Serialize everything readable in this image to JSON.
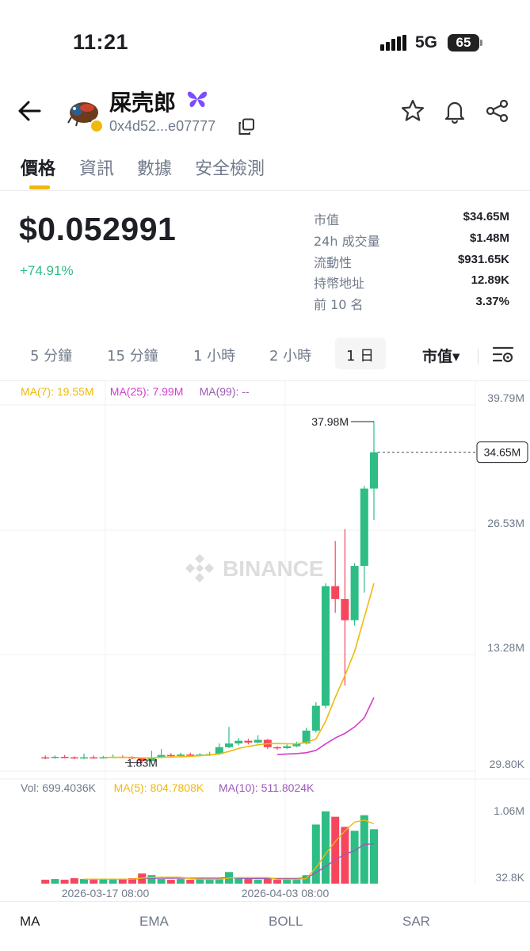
{
  "status_bar": {
    "time": "11:21",
    "network": "5G",
    "battery": "65"
  },
  "header": {
    "token_name": "屎壳郎",
    "address": "0x4d52...e07777"
  },
  "tabs": [
    {
      "label": "價格",
      "active": true
    },
    {
      "label": "資訊",
      "active": false
    },
    {
      "label": "數據",
      "active": false
    },
    {
      "label": "安全檢測",
      "active": false
    }
  ],
  "price": {
    "value": "$0.052991",
    "change": "+74.91%"
  },
  "stats": [
    {
      "label": "市值",
      "value": "$34.65M"
    },
    {
      "label": "24h 成交量",
      "value": "$1.48M"
    },
    {
      "label": "流動性",
      "value": "$931.65K"
    },
    {
      "label": "持幣地址",
      "value": "12.89K"
    },
    {
      "label": "前 10 名",
      "value": "3.37%"
    }
  ],
  "intervals": [
    {
      "label": "5 分鐘",
      "active": false
    },
    {
      "label": "15 分鐘",
      "active": false
    },
    {
      "label": "1 小時",
      "active": false
    },
    {
      "label": "2 小時",
      "active": false
    },
    {
      "label": "1 日",
      "active": true
    }
  ],
  "metric_selector": "市值▾",
  "indicators": [
    {
      "label": "MA",
      "active": true
    },
    {
      "label": "EMA",
      "active": false
    },
    {
      "label": "BOLL",
      "active": false
    },
    {
      "label": "SAR",
      "active": false
    }
  ],
  "colors": {
    "up": "#2ebd85",
    "down": "#f6465d",
    "ma7": "#f0b90b",
    "ma25": "#d63ad0",
    "ma99": "#9b59b6",
    "accent": "#f0b90b"
  },
  "chart_data": {
    "type": "candlestick",
    "ma_legend": [
      {
        "label": "MA(7): 19.55M",
        "color": "#f0b90b"
      },
      {
        "label": "MA(25): 7.99M",
        "color": "#d63ad0"
      },
      {
        "label": "MA(99): --",
        "color": "#9b59b6"
      }
    ],
    "y_ticks": [
      "39.79M",
      "26.53M",
      "13.28M",
      "29.80K"
    ],
    "y_range": [
      0.0298,
      39.79
    ],
    "current_value_label": "34.65M",
    "current_value": 34.65,
    "high_label": "37.98M",
    "low_label": "1.83M",
    "x_labels": [
      "2026-03-17 08:00",
      "2026-04-03 08:00"
    ],
    "watermark": "BINANCE",
    "candles": [
      [
        1.5,
        1.45,
        1.7,
        1.3
      ],
      [
        1.45,
        1.55,
        1.7,
        1.35
      ],
      [
        1.55,
        1.5,
        1.75,
        1.4
      ],
      [
        1.5,
        1.4,
        1.6,
        1.3
      ],
      [
        1.4,
        1.5,
        1.9,
        1.3
      ],
      [
        1.5,
        1.45,
        1.7,
        1.35
      ],
      [
        1.45,
        1.5,
        1.65,
        1.35
      ],
      [
        1.5,
        1.55,
        1.8,
        1.4
      ],
      [
        1.55,
        1.5,
        1.7,
        1.4
      ],
      [
        1.5,
        1.4,
        1.6,
        1.3
      ],
      [
        1.4,
        1.1,
        1.5,
        0.9
      ],
      [
        1.1,
        1.5,
        2.2,
        1.0
      ],
      [
        1.5,
        1.75,
        2.4,
        1.4
      ],
      [
        1.75,
        1.65,
        1.95,
        1.5
      ],
      [
        1.65,
        1.8,
        2.0,
        1.55
      ],
      [
        1.8,
        1.75,
        2.0,
        1.6
      ],
      [
        1.75,
        1.8,
        1.95,
        1.6
      ],
      [
        1.8,
        1.85,
        2.1,
        1.65
      ],
      [
        1.85,
        2.6,
        3.0,
        1.75
      ],
      [
        2.6,
        3.0,
        4.8,
        2.5
      ],
      [
        3.0,
        3.3,
        3.6,
        2.8
      ],
      [
        3.3,
        3.1,
        3.5,
        2.9
      ],
      [
        3.1,
        3.4,
        3.9,
        3.0
      ],
      [
        3.4,
        2.6,
        3.5,
        2.4
      ],
      [
        2.6,
        2.5,
        2.7,
        2.3
      ],
      [
        2.5,
        2.7,
        2.9,
        2.4
      ],
      [
        2.7,
        3.0,
        3.2,
        2.6
      ],
      [
        3.0,
        4.4,
        4.7,
        2.9
      ],
      [
        4.4,
        7.1,
        7.5,
        4.2
      ],
      [
        7.1,
        20.1,
        20.4,
        6.8
      ],
      [
        20.1,
        18.7,
        25.0,
        17.2
      ],
      [
        18.7,
        16.4,
        26.3,
        9.3
      ],
      [
        16.4,
        22.3,
        22.6,
        15.8
      ],
      [
        22.3,
        30.7,
        31.0,
        19.4
      ],
      [
        30.7,
        34.65,
        37.98,
        27.3
      ]
    ],
    "ma7": [
      null,
      null,
      null,
      null,
      null,
      null,
      1.48,
      1.5,
      1.5,
      1.49,
      1.44,
      1.44,
      1.49,
      1.53,
      1.56,
      1.6,
      1.67,
      1.75,
      1.87,
      2.14,
      2.46,
      2.68,
      2.86,
      2.98,
      3.0,
      2.97,
      2.96,
      3.1,
      3.5,
      5.4,
      8.0,
      10.4,
      13.0,
      16.7,
      20.4
    ],
    "ma25": [
      null,
      null,
      null,
      null,
      null,
      null,
      null,
      null,
      null,
      null,
      null,
      null,
      null,
      null,
      null,
      null,
      null,
      null,
      null,
      null,
      null,
      null,
      null,
      null,
      1.8,
      1.86,
      1.9,
      2.0,
      2.25,
      2.95,
      3.6,
      4.1,
      4.8,
      5.8,
      7.99
    ],
    "volume": {
      "legend": [
        {
          "label": "Vol: 699.4036K",
          "color": "#707a8a"
        },
        {
          "label": "MA(5): 804.7808K",
          "color": "#f0b90b"
        },
        {
          "label": "MA(10): 511.8024K",
          "color": "#9b59b6"
        }
      ],
      "y_ticks": [
        "1.06M",
        "32.8K"
      ],
      "y_max": 1.06,
      "values": [
        0.05,
        0.06,
        0.05,
        0.07,
        0.06,
        0.05,
        0.06,
        0.05,
        0.06,
        0.07,
        0.13,
        0.11,
        0.06,
        0.05,
        0.06,
        0.05,
        0.06,
        0.05,
        0.06,
        0.15,
        0.07,
        0.06,
        0.05,
        0.06,
        0.05,
        0.06,
        0.05,
        0.11,
        0.76,
        0.93,
        0.86,
        0.73,
        0.68,
        0.88,
        0.7
      ],
      "ma5": [
        null,
        null,
        null,
        null,
        0.058,
        0.058,
        0.058,
        0.058,
        0.058,
        0.058,
        0.072,
        0.078,
        0.082,
        0.084,
        0.082,
        0.066,
        0.058,
        0.056,
        0.056,
        0.074,
        0.078,
        0.078,
        0.078,
        0.078,
        0.058,
        0.056,
        0.056,
        0.066,
        0.206,
        0.382,
        0.542,
        0.678,
        0.792,
        0.816,
        0.77
      ],
      "ma10": [
        null,
        null,
        null,
        null,
        null,
        null,
        null,
        null,
        null,
        0.058,
        0.066,
        0.071,
        0.072,
        0.07,
        0.07,
        0.07,
        0.07,
        0.07,
        0.07,
        0.078,
        0.072,
        0.067,
        0.066,
        0.066,
        0.066,
        0.066,
        0.066,
        0.072,
        0.142,
        0.22,
        0.308,
        0.378,
        0.424,
        0.506,
        0.512
      ]
    }
  }
}
